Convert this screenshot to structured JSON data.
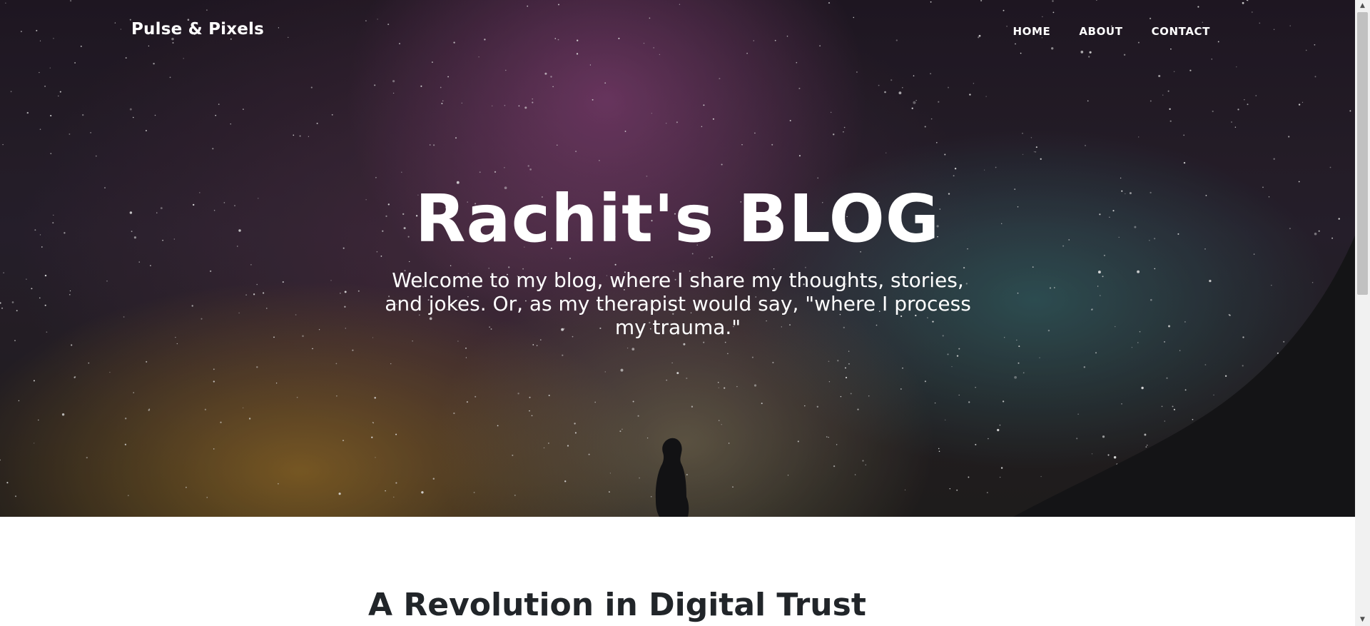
{
  "nav": {
    "brand": "Pulse & Pixels",
    "links": [
      "HOME",
      "ABOUT",
      "CONTACT"
    ]
  },
  "hero": {
    "title": "Rachit's BLOG",
    "subtitle": "Welcome to my blog, where I share my thoughts, stories, and jokes. Or, as my therapist would say, \"where I process my trauma.\""
  },
  "posts": [
    {
      "title": "A Revolution in Digital Trust"
    }
  ],
  "colors": {
    "heading_text": "#212529",
    "hero_text": "#ffffff",
    "page_background": "#ffffff"
  }
}
